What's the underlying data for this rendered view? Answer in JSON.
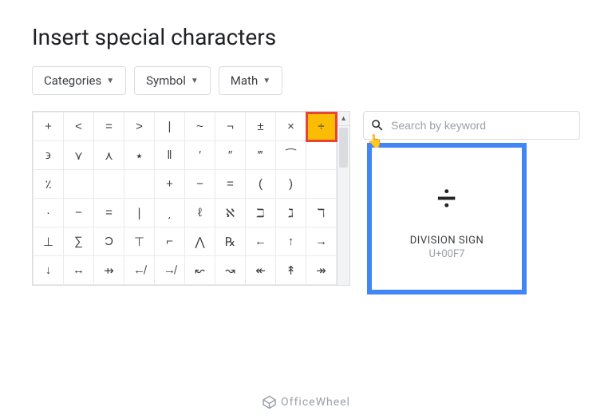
{
  "title": "Insert special characters",
  "dropdowns": {
    "categories": "Categories",
    "symbol": "Symbol",
    "math": "Math"
  },
  "search": {
    "placeholder": "Search by keyword"
  },
  "tooltip": {
    "char": "÷",
    "name": "DIVISION SIGN",
    "code": "U+00F7"
  },
  "highlighted_char": "÷",
  "grid": [
    [
      "+",
      "<",
      "=",
      ">",
      "|",
      "~",
      "¬",
      "±",
      "×",
      "÷"
    ],
    [
      "϶",
      "⋎",
      "⋏",
      "٭",
      "‖",
      "′",
      "″",
      "‴",
      "⁀",
      ""
    ],
    [
      "٪",
      "",
      "",
      "",
      "+",
      "−",
      "=",
      "(",
      ")",
      ""
    ],
    [
      "·",
      "−",
      "=",
      "∣",
      "͵",
      "ℓ",
      "ℵ",
      "ℶ",
      "ℷ",
      "ℸ"
    ],
    [
      "⊥",
      "∑",
      "Ͻ",
      "⊤",
      "⌐",
      "⋀",
      "℞",
      "←",
      "↑",
      "→"
    ],
    [
      "↓",
      "↔",
      "⇸",
      "↚",
      "↛",
      "↜",
      "↝",
      "↞",
      "↟",
      "↠"
    ]
  ],
  "watermark": "OfficeWheel"
}
